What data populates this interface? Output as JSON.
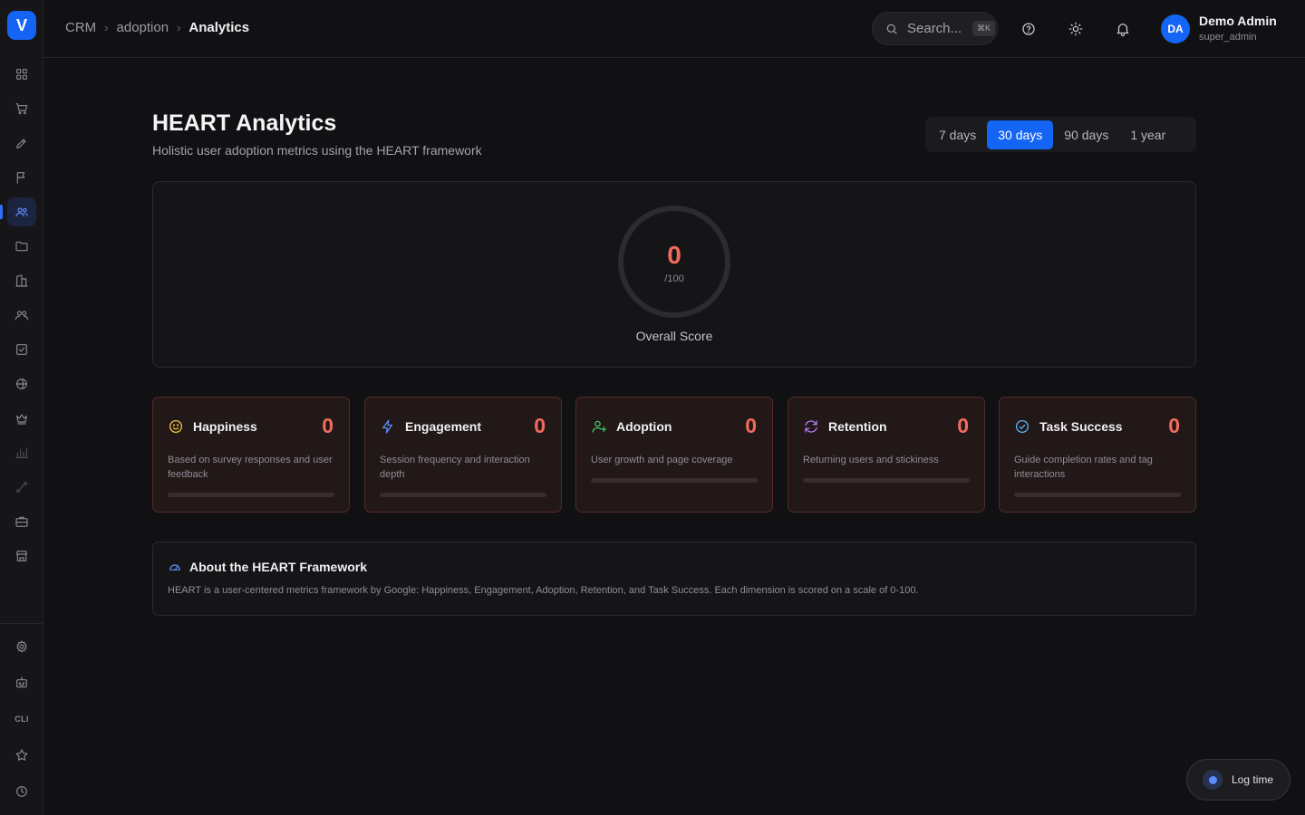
{
  "app": {
    "logo_letter": "V"
  },
  "colors": {
    "accent": "#1565f5",
    "score": "#f06b5c",
    "card_border": "#542a27"
  },
  "sidebar": {
    "items": [
      {
        "name": "dashboard-icon"
      },
      {
        "name": "cart-icon"
      },
      {
        "name": "pen-tool-icon"
      },
      {
        "name": "flag-icon"
      },
      {
        "name": "users-icon",
        "active": true
      },
      {
        "name": "folder-icon"
      },
      {
        "name": "building-icon"
      },
      {
        "name": "contacts-icon"
      },
      {
        "name": "checkbox-icon"
      },
      {
        "name": "globe-icon"
      },
      {
        "name": "crown-icon"
      },
      {
        "name": "bar-chart-icon"
      },
      {
        "name": "route-icon"
      },
      {
        "name": "briefcase-icon"
      },
      {
        "name": "store-icon"
      }
    ],
    "bottom": {
      "cli_label": "CLI"
    }
  },
  "header": {
    "breadcrumb": [
      "CRM",
      "adoption",
      "Analytics"
    ],
    "search": {
      "placeholder": "Search...",
      "shortcut": "⌘K"
    },
    "user": {
      "initials": "DA",
      "name": "Demo Admin",
      "role": "super_admin"
    }
  },
  "page": {
    "title": "HEART Analytics",
    "subtitle": "Holistic user adoption metrics using the HEART framework",
    "ranges": [
      "7 days",
      "30 days",
      "90 days",
      "1 year"
    ],
    "selected_range": "30 days"
  },
  "overall": {
    "score": "0",
    "max_label": "/100",
    "label": "Overall Score"
  },
  "metrics": [
    {
      "title": "Happiness",
      "value": "0",
      "progress": 0,
      "icon": "smile-icon",
      "icon_color": "#f5c542",
      "desc": "Based on survey responses and user feedback"
    },
    {
      "title": "Engagement",
      "value": "0",
      "progress": 0,
      "icon": "lightning-icon",
      "icon_color": "#5b8dff",
      "desc": "Session frequency and interaction depth"
    },
    {
      "title": "Adoption",
      "value": "0",
      "progress": 0,
      "icon": "user-plus-icon",
      "icon_color": "#3ecf6a",
      "desc": "User growth and page coverage"
    },
    {
      "title": "Retention",
      "value": "0",
      "progress": 0,
      "icon": "refresh-icon",
      "icon_color": "#b57cf6",
      "desc": "Returning users and stickiness"
    },
    {
      "title": "Task Success",
      "value": "0",
      "progress": 0,
      "icon": "check-circle-icon",
      "icon_color": "#5ab8f5",
      "desc": "Guide completion rates and tag interactions"
    }
  ],
  "about": {
    "title": "About the HEART Framework",
    "text": "HEART is a user-centered metrics framework by Google: Happiness, Engagement, Adoption, Retention, and Task Success. Each dimension is scored on a scale of 0-100."
  },
  "log_time": {
    "label": "Log time"
  }
}
